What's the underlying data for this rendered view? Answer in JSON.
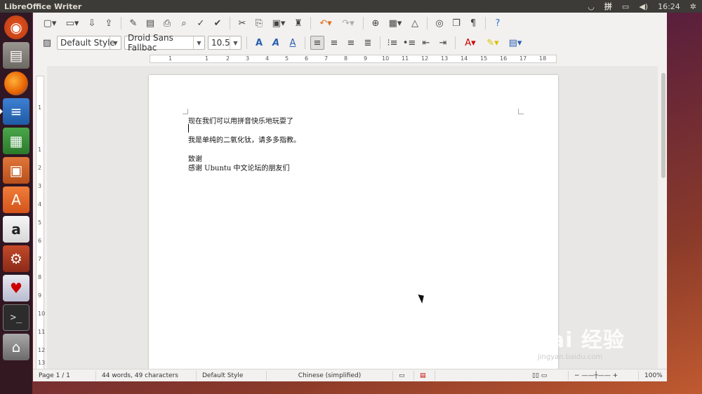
{
  "top_panel": {
    "app_title": "LibreOffice Writer",
    "clock": "16:24",
    "ime_indicator": "拼"
  },
  "launcher": {
    "items": [
      {
        "name": "ubuntu-dash",
        "icon": "ubuntu-logo-icon"
      },
      {
        "name": "files",
        "icon": "file-cabinet-icon"
      },
      {
        "name": "firefox",
        "icon": "firefox-icon"
      },
      {
        "name": "libreoffice-writer",
        "icon": "writer-icon"
      },
      {
        "name": "libreoffice-calc",
        "icon": "calc-icon"
      },
      {
        "name": "libreoffice-impress",
        "icon": "impress-icon"
      },
      {
        "name": "ubuntu-software-center",
        "icon": "shopping-bag-icon"
      },
      {
        "name": "amazon",
        "icon": "amazon-icon"
      },
      {
        "name": "system-settings",
        "icon": "settings-icon"
      },
      {
        "name": "card-game",
        "icon": "cards-icon"
      },
      {
        "name": "terminal",
        "icon": "terminal-icon"
      },
      {
        "name": "trash",
        "icon": "trash-icon"
      }
    ]
  },
  "toolbar2": {
    "paragraph_style": "Default Style",
    "font_name": "Droid Sans Fallbac",
    "font_size": "10.5"
  },
  "ruler": {
    "h_numbers": [
      "1",
      "1",
      "2",
      "3",
      "4",
      "5",
      "6",
      "7",
      "8",
      "9",
      "10",
      "11",
      "12",
      "13",
      "14",
      "15",
      "16",
      "17",
      "18"
    ],
    "v_numbers": [
      "1",
      "1",
      "2",
      "3",
      "4",
      "5",
      "6",
      "7",
      "8",
      "9",
      "10",
      "11",
      "12",
      "13"
    ]
  },
  "document": {
    "lines": [
      "现在我们可以用拼音快乐地玩耍了",
      "我是单纯的二氧化钛，请多多指教。",
      "致谢",
      "感谢 Ubuntu 中文论坛的朋友们"
    ]
  },
  "statusbar": {
    "page": "Page 1 / 1",
    "word_count": "44 words, 49 characters",
    "page_style": "Default Style",
    "language": "Chinese (simplified)",
    "zoom": "100%"
  },
  "watermark": {
    "brand": "Bai 经验",
    "url": "jingyan.baidu.com"
  }
}
